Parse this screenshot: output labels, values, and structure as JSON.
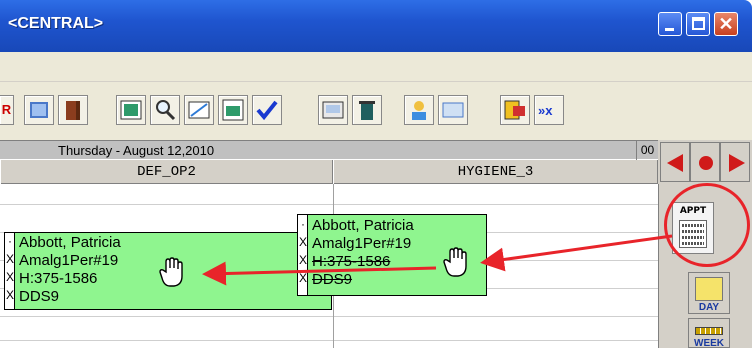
{
  "window": {
    "title": "<CENTRAL>",
    "min_icon": "minimize-icon",
    "max_icon": "maximize-icon",
    "close_icon": "close-icon",
    "close_glyph": "✕"
  },
  "toolbar": {
    "partial_label": "R",
    "buttons": [
      "notebook-icon",
      "book-icon",
      "chart-icon",
      "magnifier-icon",
      "note-icon",
      "appointment-icon",
      "checkmark-icon",
      "printer-icon",
      "trash-icon",
      "person-icon",
      "card-icon",
      "exit-icon",
      "forward-icon"
    ]
  },
  "schedule": {
    "date": "Thursday - August 12,2010",
    "corner_value": "00",
    "columns": [
      "DEF_OP2",
      "HYGIENE_3"
    ]
  },
  "appointments": [
    {
      "name": "Abbott, Patricia",
      "procedure": "Amalg1Per#19",
      "phone": "H:375-1586",
      "provider": "DDS9",
      "marks": [
        "·",
        "X",
        "X",
        "X"
      ]
    },
    {
      "name": "Abbott, Patricia",
      "procedure": "Amalg1Per#19",
      "phone": "H:375-1586",
      "provider": "DDS9",
      "marks": [
        "·",
        "X",
        "X",
        "X"
      ]
    }
  ],
  "side_panel": {
    "appt_label": "APPT",
    "day_label": "DAY",
    "week_label": "WEEK"
  },
  "annotation": {
    "color": "#e8242a"
  }
}
